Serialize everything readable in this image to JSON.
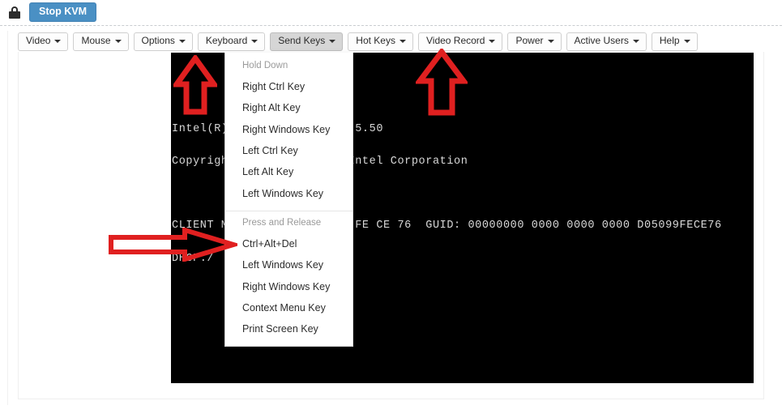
{
  "topbar": {
    "lock_icon": "lock-icon",
    "stop_kvm_label": "Stop KVM",
    "stop_kvm_color": "#4a90c4"
  },
  "toolbar": {
    "items": [
      {
        "label": "Video",
        "name": "menu-video",
        "active": false
      },
      {
        "label": "Mouse",
        "name": "menu-mouse",
        "active": false
      },
      {
        "label": "Options",
        "name": "menu-options",
        "active": false
      },
      {
        "label": "Keyboard",
        "name": "menu-keyboard",
        "active": false
      },
      {
        "label": "Send Keys",
        "name": "menu-send-keys",
        "active": true
      },
      {
        "label": "Hot Keys",
        "name": "menu-hot-keys",
        "active": false
      },
      {
        "label": "Video Record",
        "name": "menu-video-record",
        "active": false
      },
      {
        "label": "Power",
        "name": "menu-power",
        "active": false
      },
      {
        "label": "Active Users",
        "name": "menu-active-users",
        "active": false
      },
      {
        "label": "Help",
        "name": "menu-help",
        "active": false
      }
    ]
  },
  "send_keys_menu": {
    "group1_header": "Hold Down",
    "group1_items": [
      "Right Ctrl Key",
      "Right Alt Key",
      "Right Windows Key",
      "Left Ctrl Key",
      "Left Alt Key",
      "Left Windows Key"
    ],
    "group2_header": "Press and Release",
    "group2_items": [
      "Ctrl+Alt+Del",
      "Left Windows Key",
      "Right Windows Key",
      "Context Menu Key",
      "Print Screen Key"
    ]
  },
  "console": {
    "background": "#000000",
    "text_color": "#d8d8d8",
    "lines": [
      "Intel(R) Boot Agent GE v1.5.50",
      "Copyright (C) 1997-2014, Intel Corporation",
      "",
      "CLIENT MAC ADDR: D0 50 99 FE CE 76  GUID: 00000000 0000 0000 0000 D05099FECE76",
      "DHCP./"
    ]
  },
  "annotations": {
    "arrow_color": "#e02020",
    "items": [
      {
        "name": "arrow-up-keyboard",
        "direction": "up",
        "points_at": "Keyboard"
      },
      {
        "name": "arrow-up-power",
        "direction": "up",
        "points_at": "Power"
      },
      {
        "name": "arrow-right-ctrl-alt-del",
        "direction": "right",
        "points_at": "Ctrl+Alt+Del"
      }
    ]
  }
}
